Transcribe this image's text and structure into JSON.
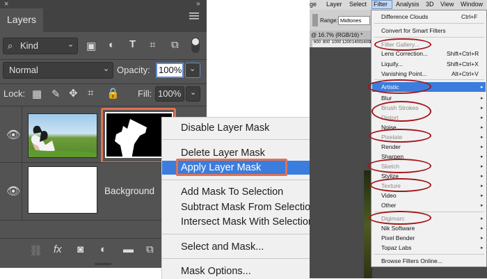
{
  "layers_panel": {
    "tab_title": "Layers",
    "filter_kind": "Kind",
    "blend_mode": "Normal",
    "opacity_label": "Opacity:",
    "opacity_value": "100%",
    "lock_label": "Lock:",
    "fill_label": "Fill:",
    "fill_value": "100%",
    "layers": [
      {
        "name": "",
        "has_mask": true
      },
      {
        "name": "Background"
      }
    ]
  },
  "context_menu": {
    "items": [
      {
        "label": "Disable Layer Mask"
      },
      {
        "label": "Delete Layer Mask"
      },
      {
        "label": "Apply Layer Mask",
        "highlighted": true
      },
      {
        "label": "Add Mask To Selection"
      },
      {
        "label": "Subtract Mask From Selection"
      },
      {
        "label": "Intersect Mask With Selection"
      },
      {
        "label": "Select and Mask..."
      },
      {
        "label": "Mask Options..."
      }
    ]
  },
  "photoshop_menubar": {
    "items": [
      "ge",
      "Layer",
      "Select",
      "Filter",
      "Analysis",
      "3D",
      "View",
      "Window"
    ]
  },
  "options_bar": {
    "range_label": "Range:",
    "range_value": "Midtones"
  },
  "document_tab": {
    "label": "@ 16.7% (RGB/16) *"
  },
  "ruler": {
    "ticks": [
      "600",
      "800",
      "1000",
      "1200",
      "1400",
      "1600",
      "1800"
    ]
  },
  "filter_menu": {
    "items": [
      {
        "label": "Difference Clouds",
        "shortcut": "Ctrl+F"
      },
      {
        "label": "Convert for Smart Filters"
      },
      {
        "label": "Filter Gallery...",
        "disabled": true
      },
      {
        "label": "Lens Correction...",
        "shortcut": "Shift+Ctrl+R"
      },
      {
        "label": "Liquify...",
        "shortcut": "Shift+Ctrl+X"
      },
      {
        "label": "Vanishing Point...",
        "shortcut": "Alt+Ctrl+V"
      },
      {
        "label": "Artistic",
        "submenu": true,
        "highlighted": true
      },
      {
        "label": "Blur",
        "submenu": true
      },
      {
        "label": "Brush Strokes",
        "submenu": true,
        "disabled": true
      },
      {
        "label": "Distort",
        "submenu": true,
        "disabled": true
      },
      {
        "label": "Noise",
        "submenu": true
      },
      {
        "label": "Pixelate",
        "submenu": true,
        "disabled": true
      },
      {
        "label": "Render",
        "submenu": true
      },
      {
        "label": "Sharpen",
        "submenu": true
      },
      {
        "label": "Sketch",
        "submenu": true,
        "disabled": true
      },
      {
        "label": "Stylize",
        "submenu": true
      },
      {
        "label": "Texture",
        "submenu": true,
        "disabled": true
      },
      {
        "label": "Video",
        "submenu": true
      },
      {
        "label": "Other",
        "submenu": true
      },
      {
        "label": "Digimarc",
        "submenu": true,
        "disabled": true
      },
      {
        "label": "Nik Software",
        "submenu": true
      },
      {
        "label": "Pixel Bender",
        "submenu": true
      },
      {
        "label": "Topaz Labs",
        "submenu": true
      },
      {
        "label": "Browse Filters Online..."
      }
    ]
  },
  "colors": {
    "panel_bg": "#535353",
    "highlight_outline": "#e07256",
    "menu_selection": "#3b7ddd",
    "annotation_oval": "#a3161b"
  }
}
